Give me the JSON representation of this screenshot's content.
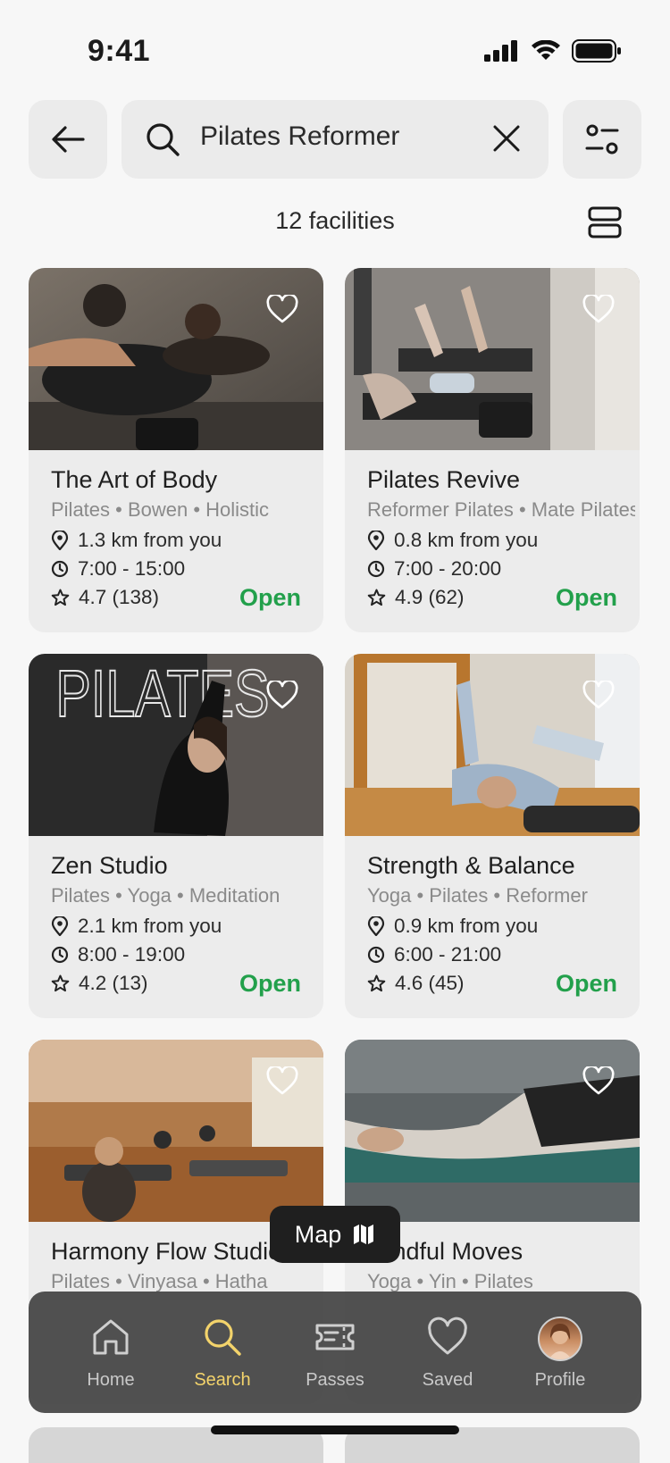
{
  "status_bar": {
    "time": "9:41"
  },
  "search": {
    "query": "Pilates Reformer"
  },
  "results": {
    "count_label": "12 facilities"
  },
  "colors": {
    "open": "#22a04b",
    "active_tab": "#f3d36b",
    "tabbar_bg": "#464646"
  },
  "cards": [
    {
      "name": "The Art of Body",
      "tags": "Pilates • Bowen • Holistic",
      "distance": "1.3 km from you",
      "hours": "7:00 - 15:00",
      "rating": "4.7 (138)",
      "status": "Open"
    },
    {
      "name": "Pilates Revive",
      "tags": "Reformer Pilates • Mate Pilates",
      "distance": "0.8 km from you",
      "hours": "7:00 - 20:00",
      "rating": "4.9 (62)",
      "status": "Open"
    },
    {
      "name": "Zen Studio",
      "tags": "Pilates • Yoga • Meditation",
      "distance": "2.1 km from you",
      "hours": "8:00 - 19:00",
      "rating": "4.2 (13)",
      "status": "Open"
    },
    {
      "name": "Strength & Balance",
      "tags": "Yoga • Pilates • Reformer",
      "distance": "0.9 km from you",
      "hours": "6:00 - 21:00",
      "rating": "4.6 (45)",
      "status": "Open"
    },
    {
      "name": "Harmony Flow Studio",
      "tags": "Pilates • Vinyasa • Hatha"
    },
    {
      "name": "Mindful Moves",
      "tags": "Yoga • Yin • Pilates"
    }
  ],
  "map_button": {
    "label": "Map"
  },
  "tabbar": {
    "items": [
      {
        "label": "Home",
        "icon": "home-icon"
      },
      {
        "label": "Search",
        "icon": "search-icon",
        "active": true
      },
      {
        "label": "Passes",
        "icon": "ticket-icon"
      },
      {
        "label": "Saved",
        "icon": "heart-icon"
      },
      {
        "label": "Profile",
        "icon": "avatar"
      }
    ]
  }
}
